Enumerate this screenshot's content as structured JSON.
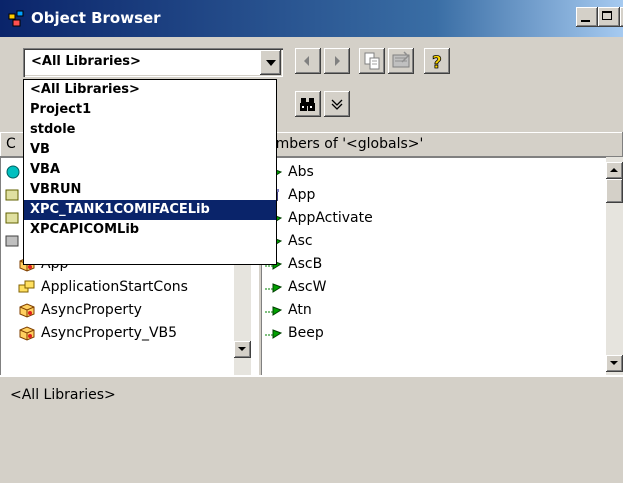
{
  "window": {
    "title": "Object Browser"
  },
  "library_combo": {
    "value": "<All Libraries>",
    "options": [
      "<All Libraries>",
      "Project1",
      "stdole",
      "VB",
      "VBA",
      "VBRUN",
      "XPC_TANK1COMIFACELib",
      "XPCAPICOMLib"
    ],
    "selected_index": 6
  },
  "classes_pane": {
    "header": "C",
    "items": [
      {
        "label": "",
        "icon": "globals-icon"
      },
      {
        "label": "",
        "icon": "module-icon"
      },
      {
        "label": "",
        "icon": "module-icon"
      },
      {
        "label": "",
        "icon": "class-icon"
      },
      {
        "label": "App",
        "icon": "class-icon"
      },
      {
        "label": "ApplicationStartCons",
        "icon": "enum-icon"
      },
      {
        "label": "AsyncProperty",
        "icon": "class-icon"
      },
      {
        "label": "AsyncProperty_VB5",
        "icon": "class-icon"
      }
    ]
  },
  "members_pane": {
    "header": "embers of '<globals>'",
    "items": [
      {
        "label": "Abs",
        "icon": "method-icon"
      },
      {
        "label": "App",
        "icon": "property-icon"
      },
      {
        "label": "AppActivate",
        "icon": "method-icon"
      },
      {
        "label": "Asc",
        "icon": "method-icon"
      },
      {
        "label": "AscB",
        "icon": "method-icon"
      },
      {
        "label": "AscW",
        "icon": "method-icon"
      },
      {
        "label": "Atn",
        "icon": "method-icon"
      },
      {
        "label": "Beep",
        "icon": "method-icon"
      }
    ]
  },
  "details_pane": {
    "text": "<All Libraries>"
  },
  "colors": {
    "titlebar": "#0a246a",
    "selection": "#0a246a",
    "face": "#d4d0c8"
  }
}
